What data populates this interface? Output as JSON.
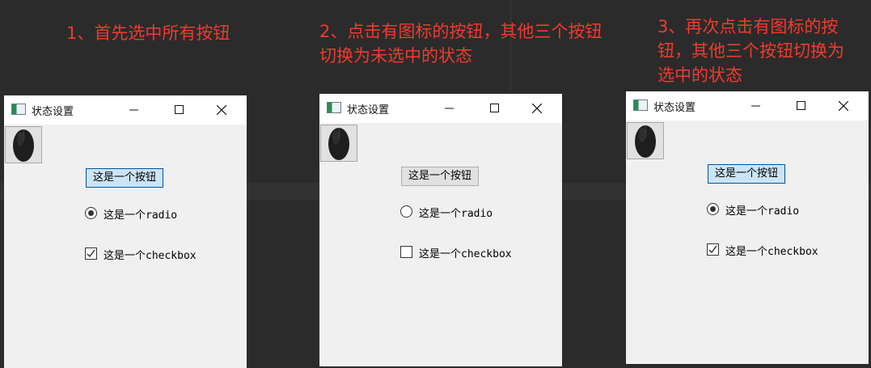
{
  "captions": {
    "step1": "1、首先选中所有按钮",
    "step2": "2、点击有图标的按钮，其他三个按钮\n切换为未选中的状态",
    "step3": "3、再次点击有图标的按\n钮，其他三个按钮切换为\n选中的状态"
  },
  "colors": {
    "caption": "#ef3b2f",
    "background": "#2b2b2b",
    "window_bg": "#f0f0f0",
    "checked_button_bg": "#cce4f7",
    "checked_button_border": "#005499"
  },
  "windows": [
    {
      "title": "状态设置",
      "icon": "window-app-icon",
      "icon_button": {
        "icon": "mouse-icon",
        "checked": true
      },
      "push_button": {
        "label": "这是一个按钮",
        "checked": true
      },
      "radio": {
        "label": "这是一个radio",
        "checked": true
      },
      "checkbox": {
        "label": "这是一个checkbox",
        "checked": true
      }
    },
    {
      "title": "状态设置",
      "icon": "window-app-icon",
      "icon_button": {
        "icon": "mouse-icon",
        "checked": false
      },
      "push_button": {
        "label": "这是一个按钮",
        "checked": false
      },
      "radio": {
        "label": "这是一个radio",
        "checked": false
      },
      "checkbox": {
        "label": "这是一个checkbox",
        "checked": false
      }
    },
    {
      "title": "状态设置",
      "icon": "window-app-icon",
      "icon_button": {
        "icon": "mouse-icon",
        "checked": true
      },
      "push_button": {
        "label": "这是一个按钮",
        "checked": true
      },
      "radio": {
        "label": "这是一个radio",
        "checked": true
      },
      "checkbox": {
        "label": "这是一个checkbox",
        "checked": true
      }
    }
  ]
}
